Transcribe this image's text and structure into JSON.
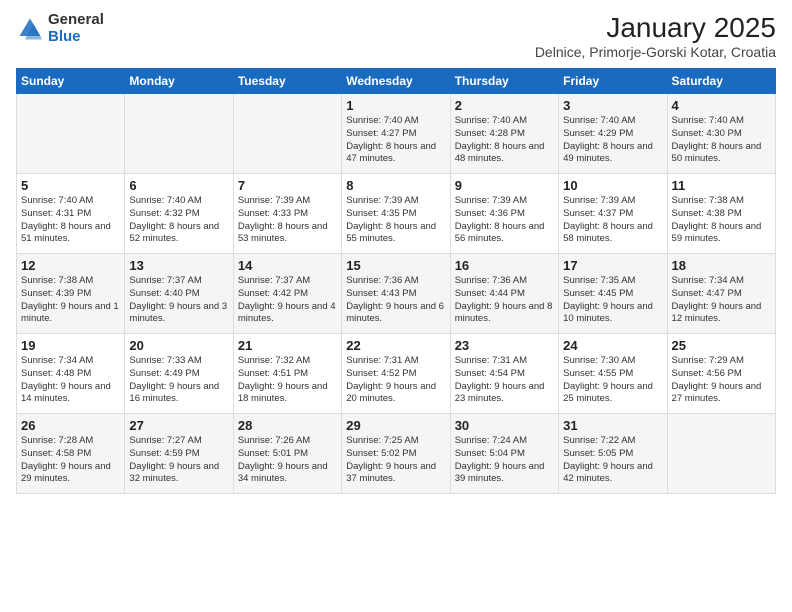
{
  "logo": {
    "general": "General",
    "blue": "Blue"
  },
  "title": "January 2025",
  "subtitle": "Delnice, Primorje-Gorski Kotar, Croatia",
  "days_of_week": [
    "Sunday",
    "Monday",
    "Tuesday",
    "Wednesday",
    "Thursday",
    "Friday",
    "Saturday"
  ],
  "weeks": [
    [
      {
        "day": "",
        "info": ""
      },
      {
        "day": "",
        "info": ""
      },
      {
        "day": "",
        "info": ""
      },
      {
        "day": "1",
        "info": "Sunrise: 7:40 AM\nSunset: 4:27 PM\nDaylight: 8 hours and 47 minutes."
      },
      {
        "day": "2",
        "info": "Sunrise: 7:40 AM\nSunset: 4:28 PM\nDaylight: 8 hours and 48 minutes."
      },
      {
        "day": "3",
        "info": "Sunrise: 7:40 AM\nSunset: 4:29 PM\nDaylight: 8 hours and 49 minutes."
      },
      {
        "day": "4",
        "info": "Sunrise: 7:40 AM\nSunset: 4:30 PM\nDaylight: 8 hours and 50 minutes."
      }
    ],
    [
      {
        "day": "5",
        "info": "Sunrise: 7:40 AM\nSunset: 4:31 PM\nDaylight: 8 hours and 51 minutes."
      },
      {
        "day": "6",
        "info": "Sunrise: 7:40 AM\nSunset: 4:32 PM\nDaylight: 8 hours and 52 minutes."
      },
      {
        "day": "7",
        "info": "Sunrise: 7:39 AM\nSunset: 4:33 PM\nDaylight: 8 hours and 53 minutes."
      },
      {
        "day": "8",
        "info": "Sunrise: 7:39 AM\nSunset: 4:35 PM\nDaylight: 8 hours and 55 minutes."
      },
      {
        "day": "9",
        "info": "Sunrise: 7:39 AM\nSunset: 4:36 PM\nDaylight: 8 hours and 56 minutes."
      },
      {
        "day": "10",
        "info": "Sunrise: 7:39 AM\nSunset: 4:37 PM\nDaylight: 8 hours and 58 minutes."
      },
      {
        "day": "11",
        "info": "Sunrise: 7:38 AM\nSunset: 4:38 PM\nDaylight: 8 hours and 59 minutes."
      }
    ],
    [
      {
        "day": "12",
        "info": "Sunrise: 7:38 AM\nSunset: 4:39 PM\nDaylight: 9 hours and 1 minute."
      },
      {
        "day": "13",
        "info": "Sunrise: 7:37 AM\nSunset: 4:40 PM\nDaylight: 9 hours and 3 minutes."
      },
      {
        "day": "14",
        "info": "Sunrise: 7:37 AM\nSunset: 4:42 PM\nDaylight: 9 hours and 4 minutes."
      },
      {
        "day": "15",
        "info": "Sunrise: 7:36 AM\nSunset: 4:43 PM\nDaylight: 9 hours and 6 minutes."
      },
      {
        "day": "16",
        "info": "Sunrise: 7:36 AM\nSunset: 4:44 PM\nDaylight: 9 hours and 8 minutes."
      },
      {
        "day": "17",
        "info": "Sunrise: 7:35 AM\nSunset: 4:45 PM\nDaylight: 9 hours and 10 minutes."
      },
      {
        "day": "18",
        "info": "Sunrise: 7:34 AM\nSunset: 4:47 PM\nDaylight: 9 hours and 12 minutes."
      }
    ],
    [
      {
        "day": "19",
        "info": "Sunrise: 7:34 AM\nSunset: 4:48 PM\nDaylight: 9 hours and 14 minutes."
      },
      {
        "day": "20",
        "info": "Sunrise: 7:33 AM\nSunset: 4:49 PM\nDaylight: 9 hours and 16 minutes."
      },
      {
        "day": "21",
        "info": "Sunrise: 7:32 AM\nSunset: 4:51 PM\nDaylight: 9 hours and 18 minutes."
      },
      {
        "day": "22",
        "info": "Sunrise: 7:31 AM\nSunset: 4:52 PM\nDaylight: 9 hours and 20 minutes."
      },
      {
        "day": "23",
        "info": "Sunrise: 7:31 AM\nSunset: 4:54 PM\nDaylight: 9 hours and 23 minutes."
      },
      {
        "day": "24",
        "info": "Sunrise: 7:30 AM\nSunset: 4:55 PM\nDaylight: 9 hours and 25 minutes."
      },
      {
        "day": "25",
        "info": "Sunrise: 7:29 AM\nSunset: 4:56 PM\nDaylight: 9 hours and 27 minutes."
      }
    ],
    [
      {
        "day": "26",
        "info": "Sunrise: 7:28 AM\nSunset: 4:58 PM\nDaylight: 9 hours and 29 minutes."
      },
      {
        "day": "27",
        "info": "Sunrise: 7:27 AM\nSunset: 4:59 PM\nDaylight: 9 hours and 32 minutes."
      },
      {
        "day": "28",
        "info": "Sunrise: 7:26 AM\nSunset: 5:01 PM\nDaylight: 9 hours and 34 minutes."
      },
      {
        "day": "29",
        "info": "Sunrise: 7:25 AM\nSunset: 5:02 PM\nDaylight: 9 hours and 37 minutes."
      },
      {
        "day": "30",
        "info": "Sunrise: 7:24 AM\nSunset: 5:04 PM\nDaylight: 9 hours and 39 minutes."
      },
      {
        "day": "31",
        "info": "Sunrise: 7:22 AM\nSunset: 5:05 PM\nDaylight: 9 hours and 42 minutes."
      },
      {
        "day": "",
        "info": ""
      }
    ]
  ]
}
